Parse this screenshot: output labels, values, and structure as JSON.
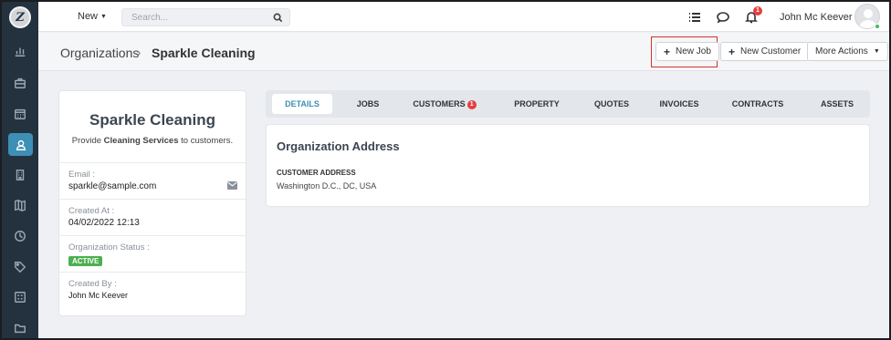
{
  "topbar": {
    "new_label": "New",
    "search_placeholder": "Search...",
    "notification_count": "1",
    "user_name": "John Mc Keever"
  },
  "breadcrumb": {
    "root": "Organizations",
    "separator": "›",
    "current": "Sparkle Cleaning"
  },
  "actions": {
    "new_job": "New Job",
    "new_customer": "New Customer",
    "more_actions": "More Actions"
  },
  "organization": {
    "name": "Sparkle Cleaning",
    "desc_prefix": "Provide",
    "desc_bold": "Cleaning Services",
    "desc_suffix": "to customers.",
    "email_label": "Email :",
    "email": "sparkle@sample.com",
    "created_at_label": "Created At :",
    "created_at": "04/02/2022 12:13",
    "status_label": "Organization Status :",
    "status": "ACTIVE",
    "created_by_label": "Created By :",
    "created_by": "John Mc Keever"
  },
  "tabs": [
    {
      "label": "DETAILS"
    },
    {
      "label": "JOBS"
    },
    {
      "label": "CUSTOMERS",
      "badge": "1"
    },
    {
      "label": "PROPERTY"
    },
    {
      "label": "QUOTES"
    },
    {
      "label": "INVOICES"
    },
    {
      "label": "CONTRACTS"
    },
    {
      "label": "ASSETS"
    }
  ],
  "details": {
    "title": "Organization Address",
    "address_label": "CUSTOMER ADDRESS",
    "address": "Washington D.C., DC, USA"
  },
  "sidebar": {
    "logo": "Z",
    "icons": [
      "chart-icon",
      "briefcase-icon",
      "calendar-icon",
      "contacts-icon",
      "building-icon",
      "map-icon",
      "clock-icon",
      "tag-icon",
      "grid-icon",
      "folder-icon"
    ],
    "active": "contacts-icon"
  },
  "colors": {
    "sidebar_bg": "#243240",
    "accent": "#3d8fb6",
    "active_badge": "#4caf50",
    "notification": "#e53e3e",
    "highlight_box": "#d9302e"
  }
}
